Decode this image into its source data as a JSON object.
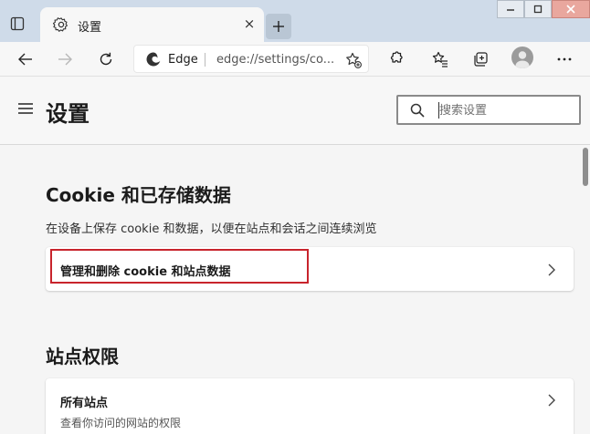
{
  "browser": {
    "tab": {
      "title": "设置",
      "close_glyph": "×"
    },
    "newtab_glyph": "+",
    "address": {
      "site_label": "Edge",
      "url": "edge://settings/co..."
    },
    "icons": [
      "tab-actions-icon",
      "gear-icon",
      "back-icon",
      "forward-icon",
      "refresh-icon",
      "edge-logo-icon",
      "add-favorite-icon",
      "extensions-icon",
      "favorites-icon",
      "collections-icon",
      "profile-avatar-icon",
      "more-icon",
      "minimize-icon",
      "maximize-icon",
      "close-icon"
    ]
  },
  "header": {
    "title": "设置",
    "search_placeholder": "搜索设置"
  },
  "sections": [
    {
      "title": "Cookie 和已存储数据",
      "description": "在设备上保存 cookie 和数据，以便在站点和会话之间连续浏览",
      "rows": [
        {
          "label": "管理和删除 cookie 和站点数据"
        }
      ]
    },
    {
      "title": "站点权限",
      "rows": [
        {
          "label": "所有站点",
          "sublabel": "查看你访问的网站的权限"
        }
      ]
    }
  ],
  "colors": {
    "tabstrip": "#cfdbe9",
    "highlight": "#c8242c",
    "page_bg": "#f5f5f5"
  }
}
